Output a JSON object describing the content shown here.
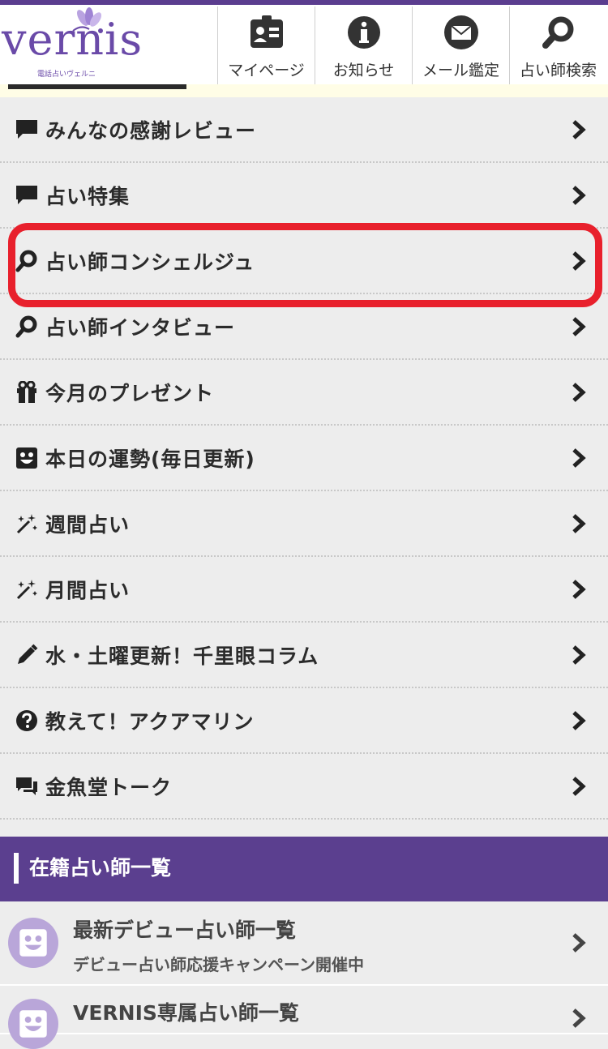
{
  "header": {
    "logo_text": "vernis",
    "logo_subtext": "電話占いヴェルニ",
    "nav": [
      {
        "label": "マイページ",
        "icon": "id-card-icon"
      },
      {
        "label": "お知らせ",
        "icon": "info-icon"
      },
      {
        "label": "メール鑑定",
        "icon": "mail-icon"
      },
      {
        "label": "占い師検索",
        "icon": "search-icon"
      }
    ]
  },
  "menu": {
    "items": [
      {
        "label": "みんなの感謝レビュー",
        "icon": "speech-bubble-icon"
      },
      {
        "label": "占い特集",
        "icon": "speech-bubble-icon"
      },
      {
        "label": "占い師コンシェルジュ",
        "icon": "search-icon"
      },
      {
        "label": "占い師インタビュー",
        "icon": "search-icon"
      },
      {
        "label": "今月のプレゼント",
        "icon": "gift-icon"
      },
      {
        "label": "本日の運勢(毎日更新)",
        "icon": "smiley-icon"
      },
      {
        "label": "週間占い",
        "icon": "magic-wand-icon"
      },
      {
        "label": "月間占い",
        "icon": "magic-wand-icon"
      },
      {
        "label": "水・土曜更新！千里眼コラム",
        "icon": "pencil-icon"
      },
      {
        "label": "教えて！アクアマリン",
        "icon": "question-icon"
      },
      {
        "label": "金魚堂トーク",
        "icon": "chat-bubbles-icon"
      }
    ],
    "highlighted": "占い師コンシェルジュ"
  },
  "section": {
    "title": "在籍占い師一覧",
    "items": [
      {
        "title": "最新デビュー占い師一覧",
        "subtitle": "デビュー占い師応援キャンペーン開催中"
      },
      {
        "title": "VERNIS専属占い師一覧",
        "subtitle": ""
      }
    ]
  },
  "colors": {
    "brand_purple": "#5b3f8f",
    "highlight_red": "#e8202c",
    "menu_bg": "#ededed"
  }
}
